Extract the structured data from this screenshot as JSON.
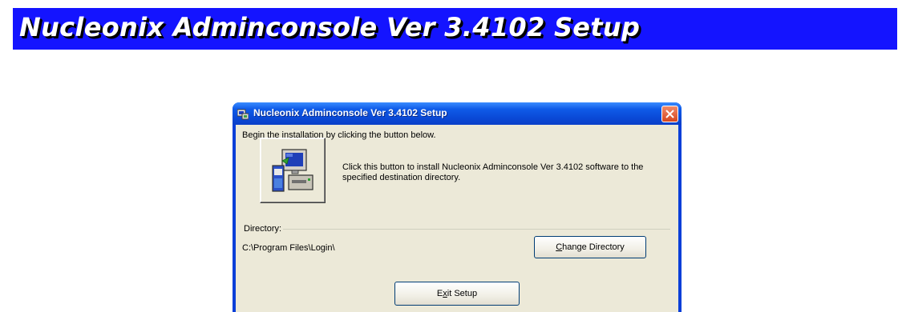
{
  "banner": {
    "title": "Nucleonix Adminconsole Ver 3.4102 Setup"
  },
  "dialog": {
    "title": "Nucleonix Adminconsole Ver 3.4102 Setup",
    "prompt": "Begin the installation by clicking the button below.",
    "install_description": "Click this button to install Nucleonix Adminconsole Ver 3.4102 software to the specified destination directory.",
    "directory_label": "Directory:",
    "directory_path": "C:\\Program Files\\Login\\",
    "change_directory": {
      "prefix": "",
      "mnemonic": "C",
      "rest": "hange Directory"
    },
    "exit_setup": {
      "prefix": "E",
      "mnemonic": "x",
      "rest": "it Setup"
    }
  },
  "colors": {
    "banner_bg": "#1414ff",
    "titlebar": "#0a49d6",
    "client_bg": "#ece9d8",
    "close_button": "#d6461e"
  },
  "icons": {
    "titlebar": "setup-computer-icon",
    "install": "install-computer-icon",
    "close": "close-icon"
  }
}
